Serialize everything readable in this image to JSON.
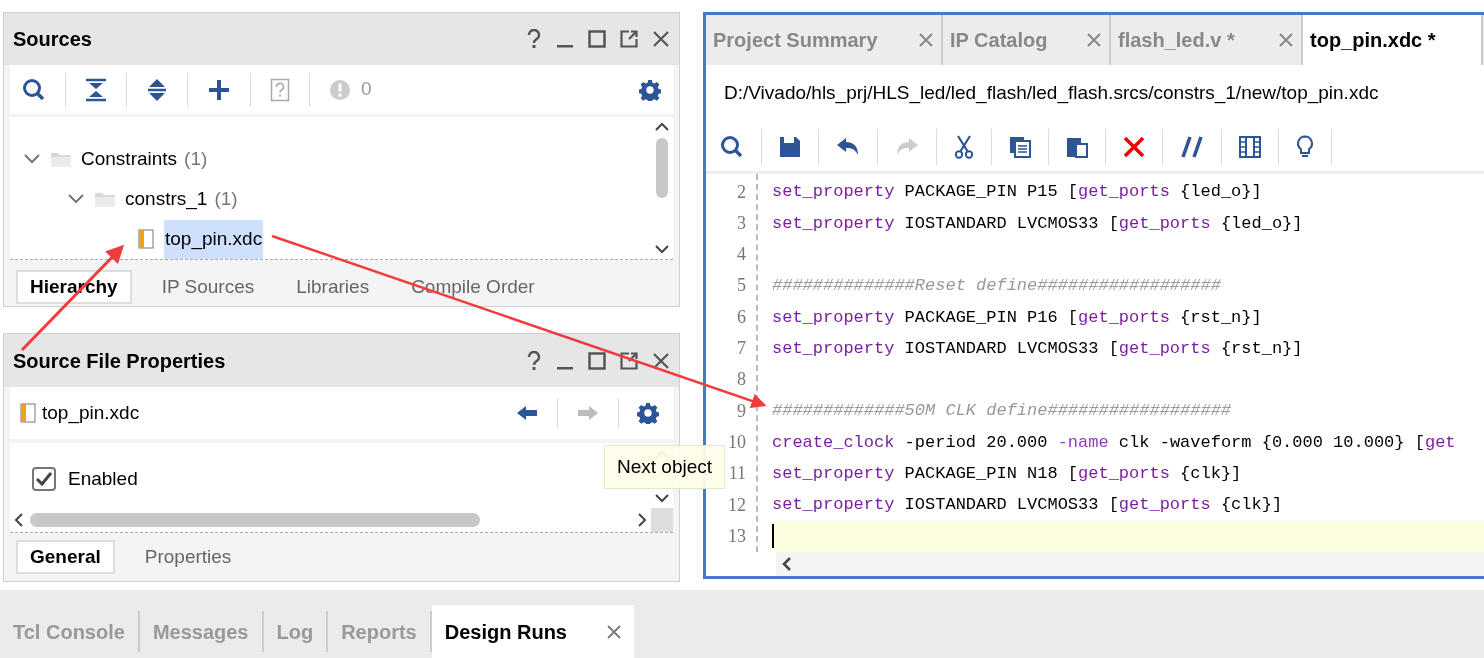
{
  "sources": {
    "title": "Sources",
    "issue_count": "0",
    "tree": [
      {
        "label": "Constraints",
        "count": "(1)",
        "kind": "folder",
        "expanded": true,
        "selected": false,
        "children": [
          {
            "label": "constrs_1",
            "count": "(1)",
            "kind": "folder",
            "expanded": true,
            "selected": false,
            "children": [
              {
                "label": "top_pin.xdc",
                "kind": "file",
                "selected": true
              }
            ]
          }
        ]
      }
    ],
    "tabs": [
      {
        "label": "Hierarchy",
        "selected": true
      },
      {
        "label": "IP Sources",
        "selected": false
      },
      {
        "label": "Libraries",
        "selected": false
      },
      {
        "label": "Compile Order",
        "selected": false
      }
    ]
  },
  "properties": {
    "title": "Source File Properties",
    "file": "top_pin.xdc",
    "fields": [
      {
        "label": "Enabled",
        "checked": true
      }
    ],
    "tabs": [
      {
        "label": "General",
        "selected": true
      },
      {
        "label": "Properties",
        "selected": false
      }
    ]
  },
  "tooltip": "Next object",
  "editor": {
    "tabs": [
      {
        "label": "Project Summary",
        "selected": false
      },
      {
        "label": "IP Catalog",
        "selected": false
      },
      {
        "label": "flash_led.v *",
        "selected": false
      },
      {
        "label": "top_pin.xdc *",
        "selected": true
      }
    ],
    "path": "D:/Vivado/hls_prj/HLS_led/led_flash/led_flash.srcs/constrs_1/new/top_pin.xdc",
    "lines": [
      {
        "number": "2",
        "current": false,
        "tokens": [
          {
            "kind": "keyword",
            "text": "set_property"
          },
          {
            "kind": "plain",
            "text": " PACKAGE_PIN P15 ["
          },
          {
            "kind": "keyword",
            "text": "get_ports"
          },
          {
            "kind": "plain",
            "text": " {led_o}]"
          }
        ]
      },
      {
        "number": "3",
        "current": false,
        "tokens": [
          {
            "kind": "keyword",
            "text": "set_property"
          },
          {
            "kind": "plain",
            "text": " IOSTANDARD LVCMOS33 ["
          },
          {
            "kind": "keyword",
            "text": "get_ports"
          },
          {
            "kind": "plain",
            "text": " {led_o}]"
          }
        ]
      },
      {
        "number": "4",
        "current": false
      },
      {
        "number": "5",
        "current": false,
        "tokens": [
          {
            "kind": "comment",
            "text": "##############Reset define##################"
          }
        ]
      },
      {
        "number": "6",
        "current": false,
        "tokens": [
          {
            "kind": "keyword",
            "text": "set_property"
          },
          {
            "kind": "plain",
            "text": " PACKAGE_PIN P16 ["
          },
          {
            "kind": "keyword",
            "text": "get_ports"
          },
          {
            "kind": "plain",
            "text": " {rst_n}]"
          }
        ]
      },
      {
        "number": "7",
        "current": false,
        "tokens": [
          {
            "kind": "keyword",
            "text": "set_property"
          },
          {
            "kind": "plain",
            "text": " IOSTANDARD LVCMOS33 ["
          },
          {
            "kind": "keyword",
            "text": "get_ports"
          },
          {
            "kind": "plain",
            "text": " {rst_n}]"
          }
        ]
      },
      {
        "number": "8",
        "current": false
      },
      {
        "number": "9",
        "current": false,
        "tokens": [
          {
            "kind": "comment",
            "text": "#############50M CLK define##################"
          }
        ]
      },
      {
        "number": "10",
        "current": false,
        "tokens": [
          {
            "kind": "keyword",
            "text": "create_clock"
          },
          {
            "kind": "plain",
            "text": " -period 20.000 "
          },
          {
            "kind": "option",
            "text": "-name"
          },
          {
            "kind": "plain",
            "text": " clk -waveform {0.000 10.000} ["
          },
          {
            "kind": "keyword",
            "text": "get"
          }
        ]
      },
      {
        "number": "11",
        "current": false,
        "tokens": [
          {
            "kind": "keyword",
            "text": "set_property"
          },
          {
            "kind": "plain",
            "text": " PACKAGE_PIN N18 ["
          },
          {
            "kind": "keyword",
            "text": "get_ports"
          },
          {
            "kind": "plain",
            "text": " {clk}]"
          }
        ]
      },
      {
        "number": "12",
        "current": false,
        "tokens": [
          {
            "kind": "keyword",
            "text": "set_property"
          },
          {
            "kind": "plain",
            "text": " IOSTANDARD LVCMOS33 ["
          },
          {
            "kind": "keyword",
            "text": "get_ports"
          },
          {
            "kind": "plain",
            "text": " {clk}]"
          }
        ]
      },
      {
        "number": "13",
        "current": true
      }
    ]
  },
  "bottom_tabs": [
    {
      "label": "Tcl Console",
      "selected": false
    },
    {
      "label": "Messages",
      "selected": false
    },
    {
      "label": "Log",
      "selected": false
    },
    {
      "label": "Reports",
      "selected": false
    },
    {
      "label": "Design Runs",
      "selected": true
    }
  ]
}
